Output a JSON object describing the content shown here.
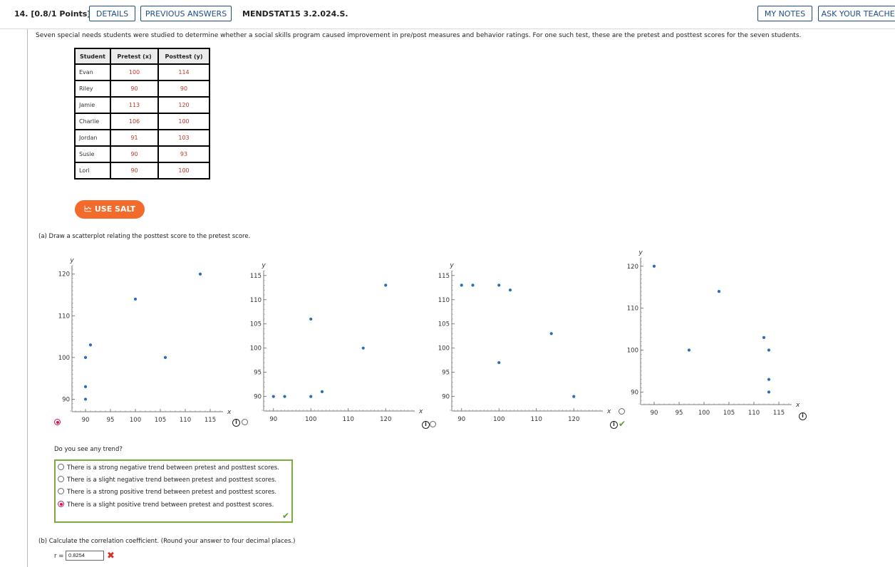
{
  "header": {
    "question": "14. [0.8/1 Points]",
    "details": "DETAILS",
    "previous": "PREVIOUS ANSWERS",
    "code": "MENDSTAT15 3.2.024.S.",
    "my_notes": "MY NOTES",
    "ask_teacher": "ASK YOUR TEACHER"
  },
  "intro": "Seven special needs students were studied to determine whether a social skills program caused improvement in pre/post measures and behavior ratings. For one such test, these are the pretest and posttest scores for the seven students.",
  "table": {
    "headers": [
      "Student",
      "Pretest (x)",
      "Posttest (y)"
    ],
    "rows": [
      [
        "Evan",
        "100",
        "114"
      ],
      [
        "Riley",
        "90",
        "90"
      ],
      [
        "Jamie",
        "113",
        "120"
      ],
      [
        "Charlie",
        "106",
        "100"
      ],
      [
        "Jordan",
        "91",
        "103"
      ],
      [
        "Susie",
        "90",
        "93"
      ],
      [
        "Lori",
        "90",
        "100"
      ]
    ]
  },
  "salt_label": "USE SALT",
  "part_a": "(a)   Draw a scatterplot relating the posttest score to the pretest score.",
  "chart_data": [
    {
      "type": "scatter",
      "xlabel": "x",
      "ylabel": "y",
      "xlim": [
        87,
        117
      ],
      "ylim": [
        87,
        122
      ],
      "xticks": [
        90,
        95,
        100,
        105,
        110,
        115
      ],
      "yticks": [
        90,
        100,
        110,
        120
      ],
      "points": [
        [
          100,
          114
        ],
        [
          90,
          90
        ],
        [
          113,
          120
        ],
        [
          106,
          100
        ],
        [
          91,
          103
        ],
        [
          90,
          93
        ],
        [
          90,
          100
        ]
      ],
      "selected": true
    },
    {
      "type": "scatter",
      "xlabel": "x",
      "ylabel": "y",
      "xlim": [
        87,
        127
      ],
      "ylim": [
        87,
        116
      ],
      "xticks": [
        90,
        100,
        110,
        120
      ],
      "yticks": [
        90,
        95,
        100,
        105,
        110,
        115
      ],
      "points": [
        [
          90,
          90
        ],
        [
          93,
          90
        ],
        [
          100,
          90
        ],
        [
          103,
          91
        ],
        [
          100,
          106
        ],
        [
          114,
          100
        ],
        [
          120,
          113
        ]
      ],
      "selected": false
    },
    {
      "type": "scatter",
      "xlabel": "x",
      "ylabel": "y",
      "xlim": [
        87,
        127
      ],
      "ylim": [
        87,
        116
      ],
      "xticks": [
        90,
        100,
        110,
        120
      ],
      "yticks": [
        90,
        95,
        100,
        105,
        110,
        115
      ],
      "points": [
        [
          90,
          113
        ],
        [
          93,
          113
        ],
        [
          100,
          113
        ],
        [
          103,
          112
        ],
        [
          100,
          97
        ],
        [
          114,
          103
        ],
        [
          120,
          90
        ]
      ],
      "selected": false
    },
    {
      "type": "scatter",
      "xlabel": "x",
      "ylabel": "y",
      "xlim": [
        87,
        117
      ],
      "ylim": [
        87,
        122
      ],
      "xticks": [
        90,
        95,
        100,
        105,
        110,
        115
      ],
      "yticks": [
        90,
        100,
        110,
        120
      ],
      "points": [
        [
          90,
          120
        ],
        [
          97,
          100
        ],
        [
          103,
          114
        ],
        [
          112,
          103
        ],
        [
          113,
          100
        ],
        [
          113,
          93
        ],
        [
          113,
          90
        ]
      ],
      "selected": false
    }
  ],
  "trend": {
    "question": "Do you see any trend?",
    "options": [
      "There is a strong negative trend between pretest and posttest scores.",
      "There is a slight negative trend between pretest and posttest scores.",
      "There is a strong positive trend between pretest and posttest scores.",
      "There is a slight positive trend between pretest and posttest scores."
    ],
    "selected": 3
  },
  "part_b": "(b)   Calculate the correlation coefficient. (Round your answer to four decimal places.)",
  "r_label": "r =",
  "r_value": "0.8254",
  "colors": {
    "accent": "#1b4f8c",
    "salt": "#f26b2b",
    "point": "#2a6ebb",
    "table_value": "#c0392b",
    "correct": "#5a9e2f",
    "wrong": "#d93025"
  }
}
